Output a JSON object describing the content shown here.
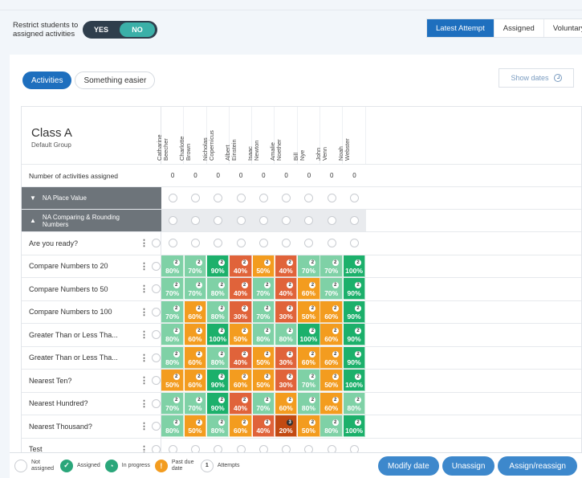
{
  "topbar": {
    "restrict_label": "Restrict students to assigned activities",
    "toggle_yes": "YES",
    "toggle_no": "NO",
    "tabs": [
      "Latest Attempt",
      "Assigned",
      "Voluntary"
    ]
  },
  "filters": {
    "activities_label": "Activities",
    "easier_label": "Something easier",
    "show_dates_label": "Show dates"
  },
  "class": {
    "name": "Class A",
    "group": "Default Group"
  },
  "students": [
    "Catharine\nBeecher",
    "Charlotte\nBrown",
    "Nicholas\nCopernicus",
    "Albert\nEinstein",
    "Isaac\nNewton",
    "Amalie\nNoether",
    "Bill\nNye",
    "John\nVenn",
    "Noah\nWebster"
  ],
  "count_row": {
    "label": "Number of activities assigned",
    "values": [
      "0",
      "0",
      "0",
      "0",
      "0",
      "0",
      "0",
      "0",
      "0"
    ]
  },
  "sections": [
    {
      "label": "NA Place Value",
      "expanded": false
    },
    {
      "label": "NA Comparing & Rounding Numbers",
      "expanded": true
    }
  ],
  "activities": [
    {
      "label": "Are you ready?",
      "scores": []
    },
    {
      "label": "Compare Numbers to 20",
      "scores": [
        "80%",
        "70%",
        "90%",
        "40%",
        "50%",
        "40%",
        "70%",
        "70%",
        "100%"
      ]
    },
    {
      "label": "Compare Numbers to 50",
      "scores": [
        "70%",
        "70%",
        "80%",
        "40%",
        "70%",
        "40%",
        "60%",
        "70%",
        "90%"
      ]
    },
    {
      "label": "Compare Numbers to 100",
      "scores": [
        "70%",
        "60%",
        "80%",
        "30%",
        "70%",
        "30%",
        "50%",
        "60%",
        "90%"
      ]
    },
    {
      "label": "Greater Than or Less Tha...",
      "scores": [
        "80%",
        "60%",
        "100%",
        "50%",
        "80%",
        "80%",
        "100%",
        "60%",
        "90%"
      ]
    },
    {
      "label": "Greater Than or Less Tha...",
      "scores": [
        "80%",
        "60%",
        "80%",
        "40%",
        "50%",
        "30%",
        "60%",
        "60%",
        "90%"
      ]
    },
    {
      "label": "Nearest Ten?",
      "scores": [
        "50%",
        "60%",
        "90%",
        "60%",
        "50%",
        "30%",
        "70%",
        "50%",
        "100%"
      ]
    },
    {
      "label": "Nearest Hundred?",
      "scores": [
        "70%",
        "70%",
        "90%",
        "40%",
        "70%",
        "60%",
        "80%",
        "60%",
        "80%"
      ]
    },
    {
      "label": "Nearest Thousand?",
      "scores": [
        "80%",
        "50%",
        "80%",
        "60%",
        "40%",
        "20%",
        "50%",
        "80%",
        "100%"
      ]
    },
    {
      "label": "Test",
      "scores": []
    }
  ],
  "attempt_badge": "2",
  "attempt_badge_alt": "3",
  "colors": {
    "high": "#1cb06b",
    "good": "#7fd1a6",
    "mid": "#f39c1f",
    "low": "#e0633a",
    "very_low": "#c24a12",
    "primary": "#1e6fbe"
  },
  "legend": {
    "not_assigned": "Not assigned",
    "assigned": "Assigned",
    "in_progress": "In progress",
    "past_due": "Past due date",
    "attempts_num": "1",
    "attempts": "Attempts"
  },
  "actions": {
    "modify_date": "Modify date",
    "unassign": "Unassign",
    "assign": "Assign/reassign"
  }
}
